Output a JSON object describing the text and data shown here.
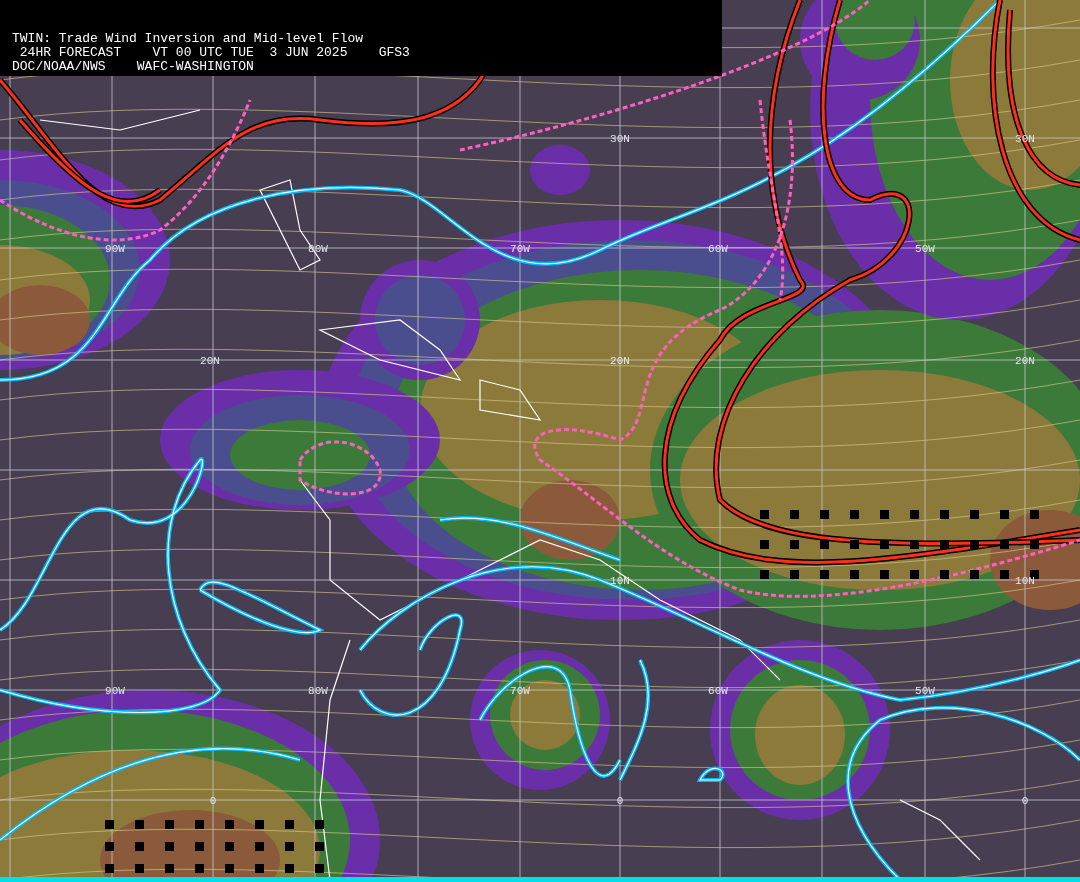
{
  "header": {
    "lines": [
      "TWIN: Trade Wind Inversion and Mid-level Flow",
      " 24HR FORECAST    VT 00 UTC TUE  3 JUN 2025    GFS3",
      "DOC/NOAA/NWS    WAFC-WASHINGTON"
    ]
  },
  "latitude_labels": [
    {
      "text": "30N"
    },
    {
      "text": "30N"
    },
    {
      "text": "20N"
    },
    {
      "text": "20N"
    },
    {
      "text": "20N"
    },
    {
      "text": "10N"
    },
    {
      "text": "10N"
    },
    {
      "text": "0"
    },
    {
      "text": "0"
    },
    {
      "text": "0"
    }
  ],
  "longitude_labels": [
    {
      "text": "90W"
    },
    {
      "text": "80W"
    },
    {
      "text": "70W"
    },
    {
      "text": "60W"
    },
    {
      "text": "50W"
    },
    {
      "text": "90W"
    },
    {
      "text": "80W"
    },
    {
      "text": "70W"
    },
    {
      "text": "60W"
    },
    {
      "text": "50W"
    }
  ]
}
